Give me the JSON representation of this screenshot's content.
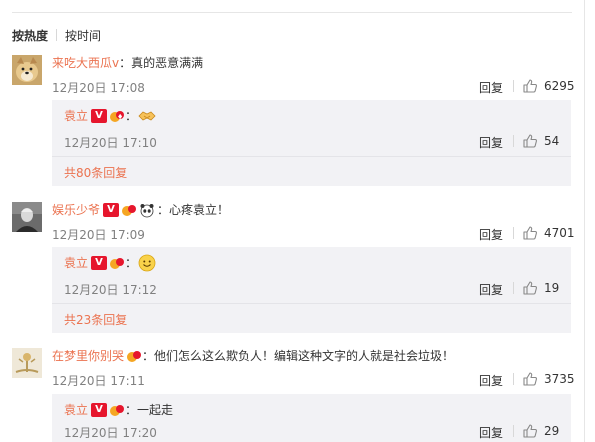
{
  "sort": {
    "hot_label": "按热度",
    "time_label": "按时间"
  },
  "comments": [
    {
      "user": "来吃大西瓜v",
      "text": "：真的恶意满满",
      "time": "12月20日 17:08",
      "reply_label": "回复",
      "likes": "6295",
      "avatar": "shiba-dog-avatar",
      "sub": {
        "user": "袁立",
        "colon": "：",
        "time": "12月20日 17:10",
        "reply_label": "回复",
        "likes": "54",
        "emoji": "handshake-emoji"
      },
      "more": "共80条回复"
    },
    {
      "user": "娱乐少爷",
      "text": "：心疼袁立！",
      "time": "12月20日 17:09",
      "reply_label": "回复",
      "likes": "4701",
      "avatar": "person-avatar",
      "sub": {
        "user": "袁立",
        "colon": "：",
        "time": "12月20日 17:12",
        "reply_label": "回复",
        "likes": "19",
        "emoji": "smile-emoji"
      },
      "more": "共23条回复"
    },
    {
      "user": "在梦里你别哭",
      "text": "：他们怎么这么欺负人！编辑这种文字的人就是社会垃圾！",
      "time": "12月20日 17:11",
      "reply_label": "回复",
      "likes": "3735",
      "avatar": "cartoon-avatar",
      "sub": {
        "user": "袁立",
        "text": "：一起走",
        "time": "12月20日 17:20",
        "reply_label": "回复",
        "likes": "29"
      }
    }
  ],
  "badges": {
    "verified_letter": "V"
  },
  "colors": {
    "username": "#eb7350",
    "subbox_bg": "#f2f2f5",
    "verified_red": "#e6162d"
  }
}
